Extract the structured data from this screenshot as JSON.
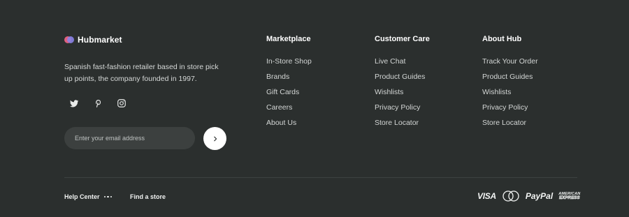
{
  "brand": {
    "name": "Hubmarket",
    "logo_icon": "hubmarket-logo-icon"
  },
  "description": "Spanish fast-fashion retailer based in store pick up points, the company founded in 1997.",
  "socials": [
    "twitter-icon",
    "pinterest-icon",
    "instagram-icon"
  ],
  "newsletter": {
    "placeholder": "Enter your email address",
    "value": "",
    "submit_icon": "chevron-right-icon"
  },
  "columns": [
    {
      "title": "Marketplace",
      "links": [
        "In-Store Shop",
        "Brands",
        "Gift Cards",
        "Careers",
        "About Us"
      ]
    },
    {
      "title": "Customer Care",
      "links": [
        "Live Chat",
        "Product Guides",
        "Wishlists",
        "Privacy Policy",
        "Store Locator"
      ]
    },
    {
      "title": "About Hub",
      "links": [
        "Track Your Order",
        "Product Guides",
        "Wishlists",
        "Privacy Policy",
        "Store Locator"
      ]
    }
  ],
  "bottom": {
    "help_center": "Help Center",
    "more_icon": "more-dots-icon",
    "find_store": "Find a store"
  },
  "payments": {
    "visa": "VISA",
    "mastercard": "MasterCard",
    "paypal": "PayPal",
    "amex_line1": "AMERICAN",
    "amex_line2": "EXPRESS"
  },
  "colors": {
    "background": "#2b2f2e",
    "input_bg": "#3c403f",
    "text": "#d3d6d5",
    "heading": "#ffffff"
  }
}
